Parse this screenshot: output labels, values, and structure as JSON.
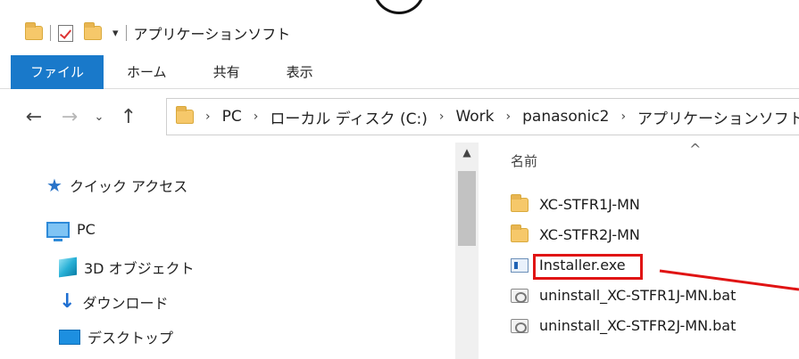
{
  "window": {
    "title": "アプリケーションソフト"
  },
  "ribbon": {
    "tabs": [
      {
        "label": "ファイル"
      },
      {
        "label": "ホーム"
      },
      {
        "label": "共有"
      },
      {
        "label": "表示"
      }
    ]
  },
  "address": {
    "crumbs": [
      "PC",
      "ローカル ディスク (C:)",
      "Work",
      "panasonic2",
      "アプリケーションソフト"
    ]
  },
  "navpane": {
    "items": [
      {
        "label": "クイック アクセス",
        "icon": "star-icon"
      },
      {
        "label": "PC",
        "icon": "pc-icon"
      },
      {
        "label": "3D オブジェクト",
        "icon": "3d-objects-icon"
      },
      {
        "label": "ダウンロード",
        "icon": "download-icon"
      },
      {
        "label": "デスクトップ",
        "icon": "desktop-icon"
      }
    ]
  },
  "filelist": {
    "column_name": "名前",
    "files": [
      {
        "name": "XC-STFR1J-MN",
        "icon": "folder-icon"
      },
      {
        "name": "XC-STFR2J-MN",
        "icon": "folder-icon"
      },
      {
        "name": "Installer.exe",
        "icon": "exe-icon"
      },
      {
        "name": "uninstall_XC-STFR1J-MN.bat",
        "icon": "bat-file-icon"
      },
      {
        "name": "uninstall_XC-STFR2J-MN.bat",
        "icon": "bat-file-icon"
      }
    ]
  },
  "colors": {
    "accent": "#1979ca",
    "highlight": "#e01414",
    "folder": "#f6c86a"
  }
}
